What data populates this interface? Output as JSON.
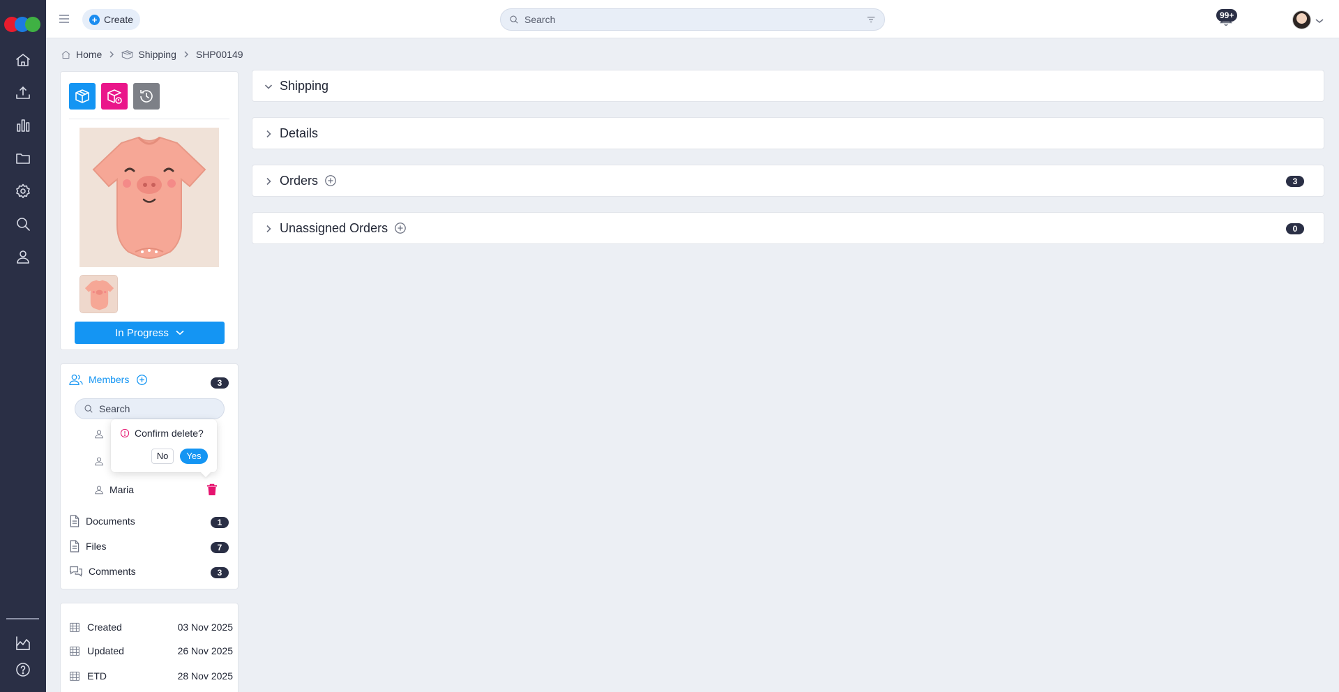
{
  "colors": {
    "rail": "#2a2f45",
    "accent": "#1495f3",
    "danger": "#e6136f",
    "page_bg": "#eceff4",
    "logo": [
      "#e81c2e",
      "#1c7be0",
      "#3fb143"
    ]
  },
  "topbar": {
    "create_label": "Create",
    "search_placeholder": "Search",
    "notifications_badge": "99+"
  },
  "rail_icons": [
    "home-icon",
    "upload-icon",
    "chart-icon",
    "folder-icon",
    "gear-icon",
    "search-icon",
    "user-icon",
    "analytics-icon",
    "help-icon"
  ],
  "breadcrumb": {
    "home": "Home",
    "shipping": "Shipping",
    "current": "SHP00149"
  },
  "media": {
    "status_label": "In Progress"
  },
  "members": {
    "title": "Members",
    "count": "3",
    "search_placeholder": "Search",
    "list": [
      "",
      "",
      "Maria"
    ]
  },
  "links": [
    {
      "label": "Documents",
      "count": "1"
    },
    {
      "label": "Files",
      "count": "7"
    },
    {
      "label": "Comments",
      "count": "3"
    }
  ],
  "popconfirm": {
    "message": "Confirm delete?",
    "no": "No",
    "yes": "Yes"
  },
  "dates": [
    {
      "label": "Created",
      "value": "03 Nov 2025"
    },
    {
      "label": "Updated",
      "value": "26 Nov 2025"
    },
    {
      "label": "ETD",
      "value": "28 Nov 2025"
    }
  ],
  "sections": {
    "shipping": {
      "title": "Shipping"
    },
    "details": {
      "title": "Details"
    },
    "orders": {
      "title": "Orders",
      "count": "3"
    },
    "unassigned": {
      "title": "Unassigned Orders",
      "count": "0"
    }
  }
}
